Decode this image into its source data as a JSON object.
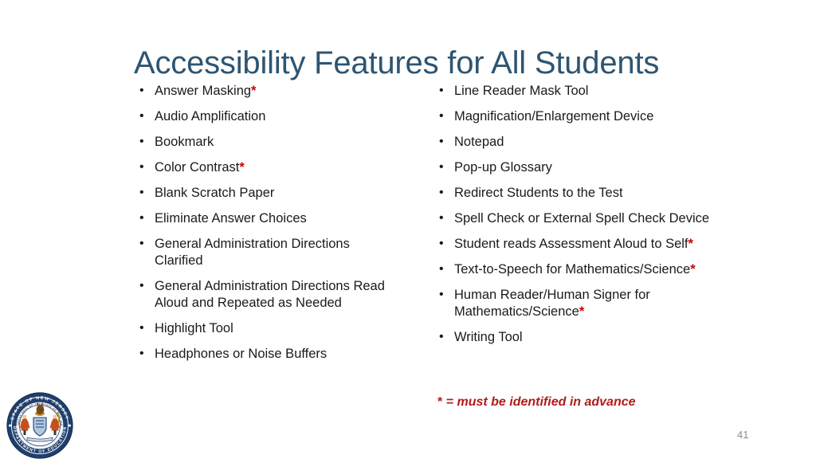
{
  "slide": {
    "title": "Accessibility Features for All Students",
    "page_number": "41",
    "background_color": "#FFFFFF",
    "title_color": "#2E5572",
    "asterisk_color": "#CC0000",
    "footnote_color": "#B01C1C",
    "body_text_color": "#1A1A1A"
  },
  "columns": {
    "left": [
      {
        "text": "Answer Masking",
        "required_in_advance": true
      },
      {
        "text": "Audio Amplification",
        "required_in_advance": false
      },
      {
        "text": "Bookmark",
        "required_in_advance": false
      },
      {
        "text": "Color Contrast",
        "required_in_advance": true
      },
      {
        "text": "Blank Scratch Paper",
        "required_in_advance": false
      },
      {
        "text": "Eliminate Answer Choices",
        "required_in_advance": false
      },
      {
        "text": "General Administration Directions Clarified",
        "required_in_advance": false
      },
      {
        "text": "General Administration Directions Read Aloud and Repeated as Needed",
        "required_in_advance": false
      },
      {
        "text": "Highlight Tool",
        "required_in_advance": false
      },
      {
        "text": "Headphones or Noise Buffers",
        "required_in_advance": false
      }
    ],
    "right": [
      {
        "text": "Line Reader Mask Tool",
        "required_in_advance": false
      },
      {
        "text": "Magnification/Enlargement Device",
        "required_in_advance": false
      },
      {
        "text": "Notepad",
        "required_in_advance": false
      },
      {
        "text": "Pop-up Glossary",
        "required_in_advance": false
      },
      {
        "text": "Redirect Students to the Test",
        "required_in_advance": false
      },
      {
        "text": "Spell Check or External Spell Check Device",
        "required_in_advance": false
      },
      {
        "text": "Student reads Assessment Aloud to Self",
        "required_in_advance": true
      },
      {
        "text": "Text-to-Speech for Mathematics/Science",
        "required_in_advance": true
      },
      {
        "text": "Human Reader/Human Signer for Mathematics/Science",
        "required_in_advance": true
      },
      {
        "text": "Writing Tool",
        "required_in_advance": false
      }
    ]
  },
  "footnote": {
    "marker": "*",
    "text": " = must be identified in advance"
  },
  "logo": {
    "name": "new-jersey-department-of-education-seal",
    "top_text": "STATE OF NEW JERSEY",
    "bottom_text": "DEPARTMENT OF EDUCATION",
    "inner_top_text": "THE GREAT SEAL OF THE STATE OF NEW JERSEY",
    "ring_color": "#1F3F6E",
    "shield_color": "#AFC8E0",
    "figure_color": "#C4501E"
  }
}
